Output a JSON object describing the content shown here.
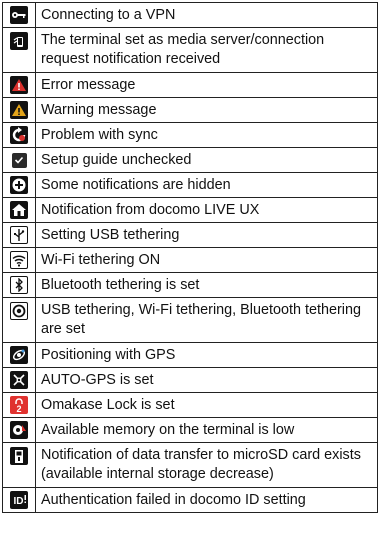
{
  "rows": [
    {
      "icon": "vpn-key-icon",
      "color": "#111111",
      "glyph": "o━",
      "text": "Connecting to a VPN"
    },
    {
      "icon": "media-server-icon",
      "color": "#111111",
      "glyph": "▮",
      "text": "The terminal set as media server/connection request notification received"
    },
    {
      "icon": "error-icon",
      "color": "#111111",
      "glyph": "▲",
      "text": "Error message"
    },
    {
      "icon": "warning-icon",
      "color": "#111111",
      "glyph": "▲",
      "text": "Warning message"
    },
    {
      "icon": "sync-problem-icon",
      "color": "#111111",
      "glyph": "↻",
      "text": "Problem with sync"
    },
    {
      "icon": "checkbox-icon",
      "color": "#222222",
      "glyph": "✓",
      "text": "Setup guide unchecked"
    },
    {
      "icon": "plus-icon",
      "color": "#111111",
      "glyph": "+",
      "text": "Some notifications are hidden"
    },
    {
      "icon": "home-icon",
      "color": "#111111",
      "glyph": "⌂",
      "text": "Notification from docomo LIVE UX"
    },
    {
      "icon": "usb-icon",
      "color": "#ffffff",
      "glyph": "Ψ",
      "text": "Setting USB tethering"
    },
    {
      "icon": "wifi-icon",
      "color": "#ffffff",
      "glyph": "≋",
      "text": "Wi-Fi tethering ON"
    },
    {
      "icon": "bluetooth-icon",
      "color": "#ffffff",
      "glyph": "ᛒ",
      "text": "Bluetooth tethering is set"
    },
    {
      "icon": "tethering-all-icon",
      "color": "#ffffff",
      "glyph": "◉",
      "text": "USB tethering, Wi-Fi tethering, Bluetooth tethering are set"
    },
    {
      "icon": "gps-icon",
      "color": "#111111",
      "glyph": "✦",
      "text": "Positioning with GPS"
    },
    {
      "icon": "auto-gps-icon",
      "color": "#111111",
      "glyph": "✦",
      "text": "AUTO-GPS is set"
    },
    {
      "icon": "lock-icon",
      "color": "#e0322f",
      "glyph": "2",
      "text": "Omakase Lock is set"
    },
    {
      "icon": "memory-low-icon",
      "color": "#111111",
      "glyph": "●",
      "text": "Available memory on the terminal is low"
    },
    {
      "icon": "sd-card-icon",
      "color": "#111111",
      "glyph": "▮",
      "text": "Notification of data transfer to microSD card exists (available internal storage decrease)"
    },
    {
      "icon": "docomo-id-icon",
      "color": "#111111",
      "glyph": "ID",
      "text": "Authentication failed in docomo ID setting"
    }
  ]
}
